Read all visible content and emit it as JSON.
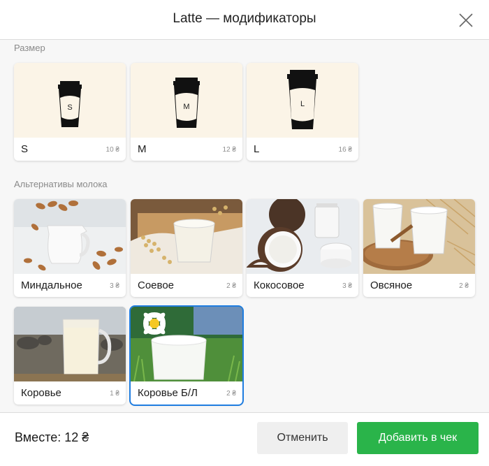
{
  "header": {
    "title": "Latte — модификаторы",
    "close_icon": "close-icon"
  },
  "sections": {
    "size": {
      "label": "Размер"
    },
    "milk": {
      "label": "Альтернативы молока"
    }
  },
  "size_items": [
    {
      "name": "S",
      "price": "10 ₴",
      "letter": "S",
      "selected": true
    },
    {
      "name": "M",
      "price": "12 ₴",
      "letter": "M",
      "selected": false
    },
    {
      "name": "L",
      "price": "16 ₴",
      "letter": "L",
      "selected": false
    }
  ],
  "milk_items": [
    {
      "name": "Миндальное",
      "price": "3 ₴",
      "selected": false
    },
    {
      "name": "Соевое",
      "price": "2 ₴",
      "selected": false
    },
    {
      "name": "Кокосовое",
      "price": "3 ₴",
      "selected": false
    },
    {
      "name": "Овсяное",
      "price": "2 ₴",
      "selected": false
    },
    {
      "name": "Коровье",
      "price": "1 ₴",
      "selected": false
    },
    {
      "name": "Коровье Б/Л",
      "price": "2 ₴",
      "selected": true
    }
  ],
  "footer": {
    "total": "Вместе: 12 ₴",
    "cancel_label": "Отменить",
    "add_label": "Добавить в чек"
  },
  "colors": {
    "selected": "#1f7de0",
    "add_button": "#2ab44a",
    "size_background": "#fbf4e7"
  }
}
